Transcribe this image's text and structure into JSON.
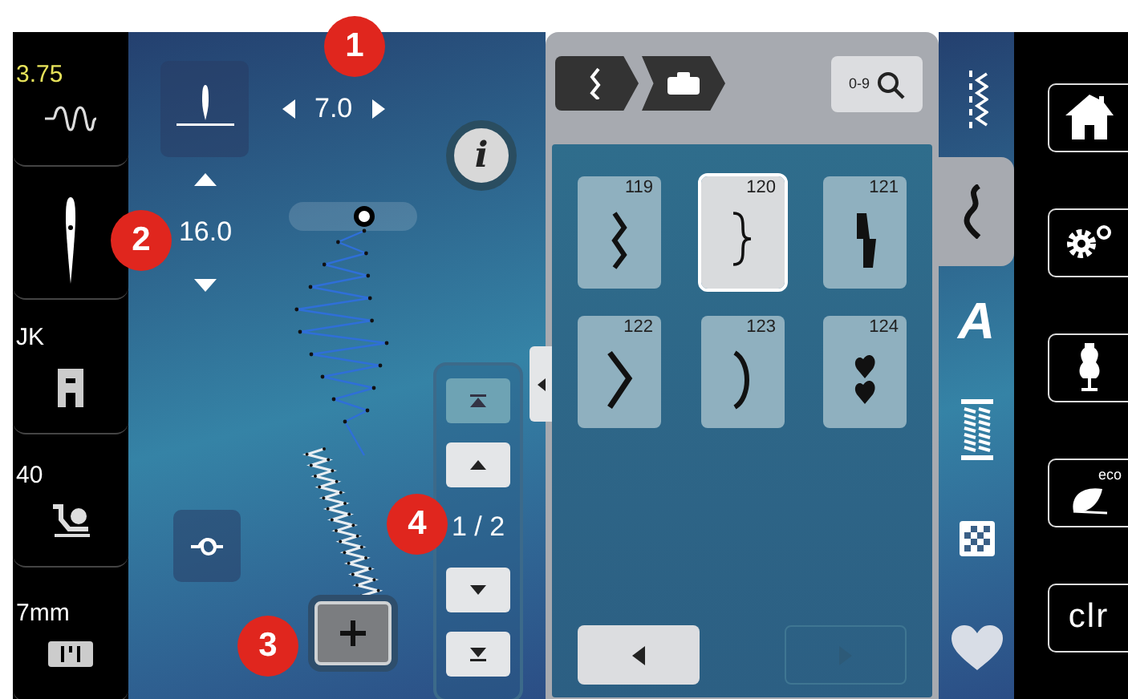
{
  "status_panel": [
    {
      "kind": "thread",
      "value": "3.75"
    },
    {
      "kind": "needle"
    },
    {
      "kind": "foot",
      "value": "JK"
    },
    {
      "kind": "tension",
      "value": "40"
    },
    {
      "kind": "plate",
      "value": "7mm"
    }
  ],
  "stitch_width": {
    "value": "7.0"
  },
  "stitch_length": {
    "value": "16.0"
  },
  "scroll_buttons": [
    {
      "kind": "first",
      "disabled": true
    },
    {
      "kind": "up",
      "disabled": false
    },
    {
      "kind": "down",
      "disabled": false
    },
    {
      "kind": "last",
      "disabled": false
    }
  ],
  "page_indicator": "1 / 2",
  "info_button": {
    "label": "i"
  },
  "callouts": [
    "1",
    "2",
    "3",
    "4"
  ],
  "search_button": {
    "label": "0-9"
  },
  "stitches": [
    {
      "number": "119",
      "selected": false
    },
    {
      "number": "120",
      "selected": true
    },
    {
      "number": "121",
      "selected": false
    },
    {
      "number": "122",
      "selected": false
    },
    {
      "number": "123",
      "selected": false
    },
    {
      "number": "124",
      "selected": false
    }
  ],
  "pager": [
    {
      "kind": "prev",
      "disabled": false
    },
    {
      "kind": "next",
      "disabled": true
    }
  ],
  "category_tabs": [
    {
      "kind": "utility",
      "selected": false
    },
    {
      "kind": "decorative",
      "selected": true
    },
    {
      "kind": "alphabet",
      "label": "A",
      "selected": false
    },
    {
      "kind": "buttonhole",
      "selected": false
    },
    {
      "kind": "quilt",
      "selected": false
    },
    {
      "kind": "personal",
      "selected": false
    }
  ],
  "side_buttons": [
    {
      "kind": "home"
    },
    {
      "kind": "settings"
    },
    {
      "kind": "tutor"
    },
    {
      "kind": "eco",
      "label": "eco"
    },
    {
      "kind": "clear",
      "label": "clr"
    }
  ]
}
